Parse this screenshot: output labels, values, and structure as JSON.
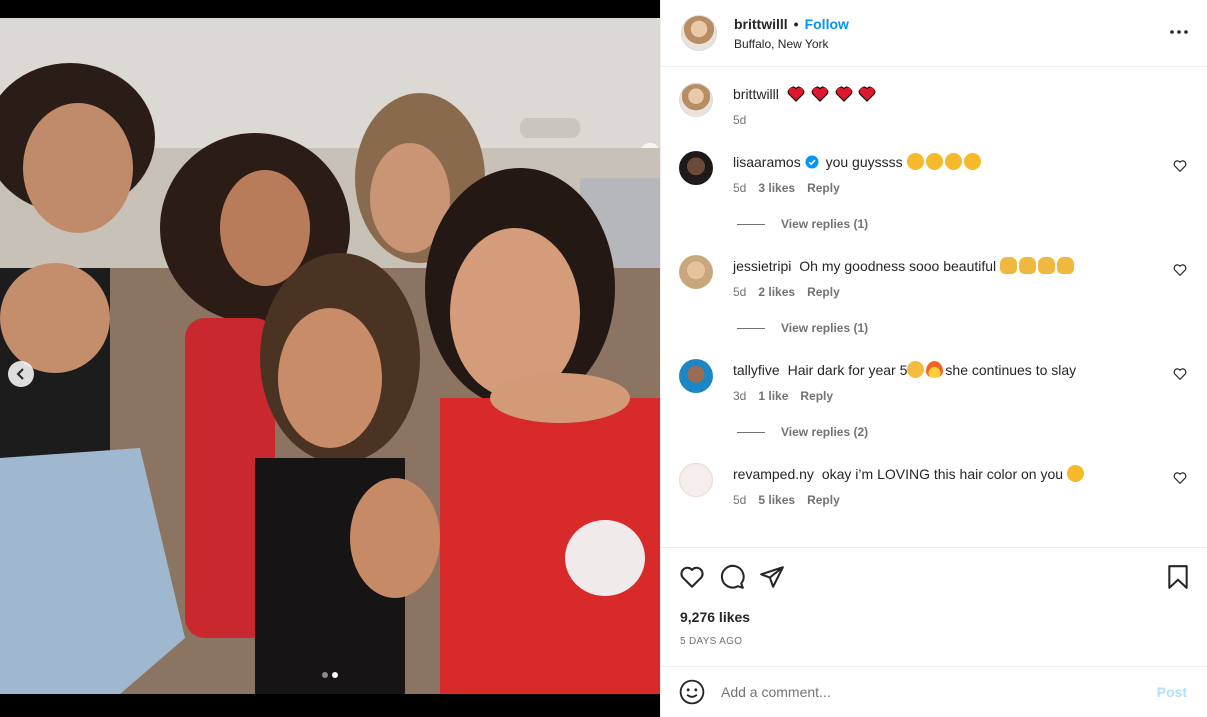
{
  "post": {
    "username": "brittwilll",
    "follow_label": "Follow",
    "separator": "•",
    "location": "Buffalo, New York",
    "caption": {
      "username": "brittwilll",
      "time": "5d"
    },
    "likes": "9,276 likes",
    "age": "5 DAYS AGO"
  },
  "comments": [
    {
      "username": "lisaaramos",
      "verified": true,
      "text": "you guyssss",
      "emoji": [
        "smiling-face-with-heart-eyes",
        "smiling-face-with-heart-eyes",
        "smiling-face-with-heart-eyes",
        "smiling-face-with-heart-eyes"
      ],
      "time": "5d",
      "likes": "3 likes",
      "reply": "Reply",
      "view_replies": "View replies (1)"
    },
    {
      "username": "jessietripi",
      "verified": false,
      "text": "Oh my goodness sooo beautiful",
      "emoji": [
        "raising-hands",
        "raising-hands",
        "raising-hands",
        "raising-hands"
      ],
      "time": "5d",
      "likes": "2 likes",
      "reply": "Reply",
      "view_replies": "View replies (1)"
    },
    {
      "username": "tallyfive",
      "verified": false,
      "text_a": "Hair dark for year 5",
      "text_b": "she continues to slay",
      "emoji": [
        "clapping-hands",
        "fire"
      ],
      "time": "3d",
      "likes": "1 like",
      "reply": "Reply",
      "view_replies": "View replies (2)"
    },
    {
      "username": "revamped.ny",
      "verified": false,
      "text": "okay i’m LOVING this hair color on you",
      "emoji": [
        "smiling-face-with-heart-eyes"
      ],
      "time": "5d",
      "likes": "5 likes",
      "reply": "Reply"
    }
  ],
  "add_comment": {
    "placeholder": "Add a comment...",
    "post_label": "Post"
  },
  "icons": [
    "more-icon",
    "heart-icon",
    "comment-icon",
    "share-icon",
    "save-icon",
    "emoji-icon",
    "carousel-prev-icon"
  ],
  "colors": {
    "follow": "#0095f6",
    "post_disabled": "#b2dffc",
    "heart": "#ed4956"
  }
}
